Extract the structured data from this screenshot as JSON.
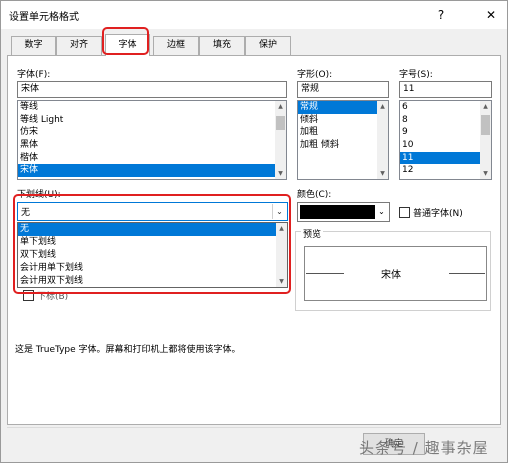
{
  "title": "设置单元格格式",
  "titlebar_buttons": {
    "help": "?",
    "close": "✕"
  },
  "tabs": [
    "数字",
    "对齐",
    "字体",
    "边框",
    "填充",
    "保护"
  ],
  "font": {
    "label": "字体(F):",
    "value": "宋体",
    "items": [
      "等线",
      "等线 Light",
      "仿宋",
      "黑体",
      "楷体",
      "宋体"
    ],
    "selected": "宋体"
  },
  "style": {
    "label": "字形(O):",
    "value": "常规",
    "items": [
      "常规",
      "倾斜",
      "加粗",
      "加粗 倾斜"
    ],
    "selected": "常规"
  },
  "size": {
    "label": "字号(S):",
    "value": "11",
    "items": [
      "6",
      "8",
      "9",
      "10",
      "11",
      "12"
    ],
    "selected": "11"
  },
  "underline": {
    "label": "下划线(U):",
    "value": "无",
    "options": [
      "无",
      "单下划线",
      "双下划线",
      "会计用单下划线",
      "会计用双下划线"
    ],
    "selected": "无"
  },
  "color": {
    "label": "颜色(C):",
    "value_hex": "#000000"
  },
  "normal_font": {
    "label": "普通字体(N)"
  },
  "effects": {
    "partial": "下标(B)"
  },
  "preview": {
    "label": "预览",
    "sample": "宋体"
  },
  "info_text": "这是 TrueType 字体。屏幕和打印机上都将使用该字体。",
  "buttons": {
    "ok": "确定"
  },
  "watermark": "头条号 / 趣事杂屋",
  "colors": {
    "accent": "#0078d7",
    "highlight": "#e02020"
  }
}
